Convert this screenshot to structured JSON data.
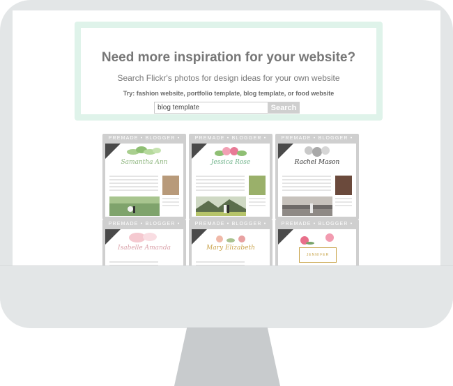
{
  "search": {
    "headline": "Need more inspiration for your website?",
    "subline": "Search Flickr's photos for design ideas for your own website",
    "try_line": "Try: fashion website, portfolio template, blog template, or food website",
    "input_value": "blog template",
    "button_label": "Search"
  },
  "colors": {
    "monitor_frame": "#e3e6e7",
    "panel_border": "#dff3ea",
    "heading_text": "#777777",
    "search_button": "#cfcfcf"
  },
  "thumbnails": [
    {
      "banner": "PREMADE • BLOGGER • TEMPLATE",
      "title": "Samantha Ann",
      "title_color": "#8ab37a",
      "floral": "green-leaves",
      "photo": "garden-wedding"
    },
    {
      "banner": "PREMADE • BLOGGER • TEMPLATE",
      "title": "Jessica Rose",
      "title_color": "#6fb38a",
      "floral": "pink-roses",
      "photo": "mountain-couple"
    },
    {
      "banner": "PREMADE • BLOGGER • TEMPLATE",
      "title": "Rachel Mason",
      "title_color": "#333333",
      "floral": "grey-flowers",
      "photo": "beach-sunset"
    },
    {
      "banner": "PREMADE • BLOGGER • TEMPLATE",
      "title": "Isabelle Amanda",
      "title_color": "#d9a0a8",
      "floral": "pink-watercolor",
      "photo": ""
    },
    {
      "banner": "PREMADE • BLOGGER • TEMPLATE",
      "title": "Mary Elizabeth",
      "title_color": "#c9a24a",
      "floral": "blush-flowers",
      "photo": ""
    },
    {
      "banner": "PREMADE • BLOGGER • TEMPLATE",
      "title": "JENNIFER LAUREN",
      "title_color": "#c8a44a",
      "floral": "gold-frame-roses",
      "photo": ""
    }
  ]
}
